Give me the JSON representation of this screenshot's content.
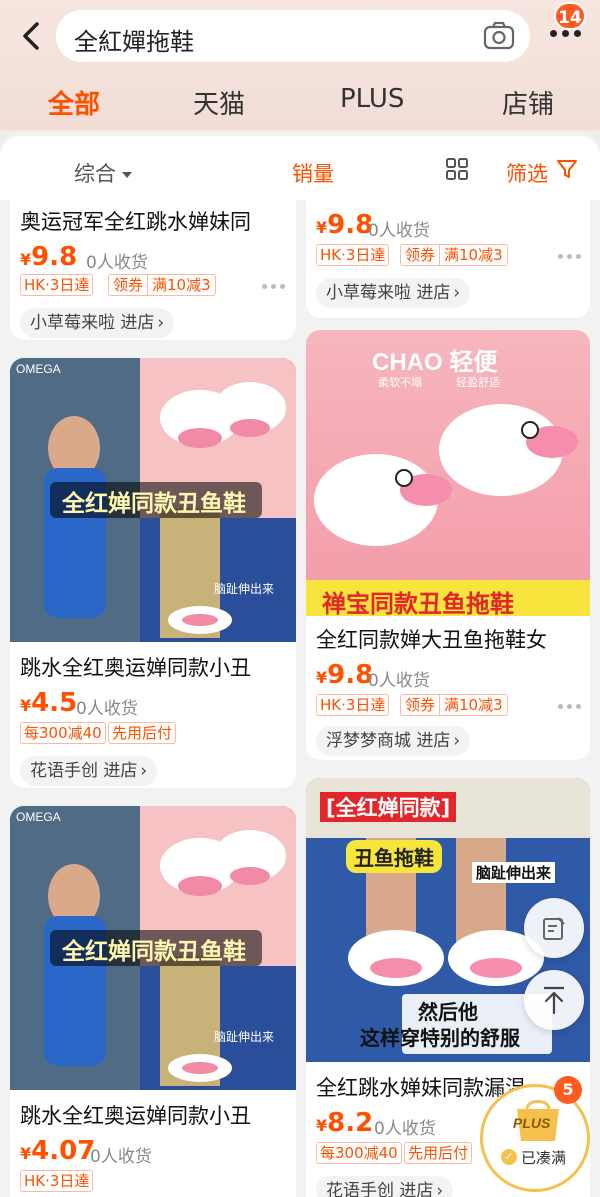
{
  "search": {
    "query": "全紅嬋拖鞋"
  },
  "header": {
    "notification_count": "14"
  },
  "tabs": [
    {
      "label": "全部"
    },
    {
      "label": "天猫"
    },
    {
      "label": "PLUS"
    },
    {
      "label": "店铺"
    }
  ],
  "filters": {
    "sort": "综合",
    "sales": "销量",
    "filter": "筛选"
  },
  "products": [
    {
      "title": "奥运冠军全红跳水婵妹同",
      "yen": "¥",
      "price": "9.8",
      "sold": "0人收货",
      "tags": [
        "HK·3日達"
      ],
      "coupon_tag": [
        "领券",
        "满10减3"
      ],
      "store": "小草莓来啦 进店"
    },
    {
      "title": "",
      "yen": "¥",
      "price": "9.8",
      "sold": "0人收货",
      "tags": [
        "HK·3日達"
      ],
      "coupon_tag": [
        "领券",
        "满10减3"
      ],
      "store": "小草莓来啦 进店"
    },
    {
      "title": "跳水全红奥运婵同款小丑",
      "yen": "¥",
      "price": "4.5",
      "sold": "0人收货",
      "tags": [
        "每300减40",
        "先用后付"
      ],
      "store": "花语手创 进店",
      "image_text": {
        "brand": "OMEGA",
        "overlay": "全红婵同款丑鱼鞋",
        "caption": "脑趾伸出来"
      }
    },
    {
      "title": "全红同款婵大丑鱼拖鞋女",
      "yen": "¥",
      "price": "9.8",
      "sold": "0人收货",
      "tags": [
        "HK·3日達"
      ],
      "coupon_tag": [
        "领券",
        "满10减3"
      ],
      "store": "浮梦梦商城 进店",
      "image_text": {
        "headline": "CHAO 轻便",
        "sub1": "柔软不塌",
        "sub2": "轻盈舒适",
        "banner": "禅宝同款丑鱼拖鞋"
      }
    },
    {
      "title": "跳水全红奥运婵同款小丑",
      "yen": "¥",
      "price": "4.07",
      "sold": "0人收货",
      "tags": [
        "HK·3日達"
      ],
      "store": "",
      "image_text": {
        "brand": "OMEGA",
        "overlay": "全红婵同款丑鱼鞋",
        "caption": "脑趾伸出来"
      }
    },
    {
      "title": "全红跳水婵妹同款漏温",
      "yen": "¥",
      "price": "8.2",
      "sold": "0人收货",
      "tags": [
        "每300减40",
        "先用后付"
      ],
      "store": "花语手创 进店",
      "image_text": {
        "top": "[全红婵同款]",
        "label": "丑鱼拖鞋",
        "caption": "脑趾伸出来",
        "bottom1": "然后他",
        "bottom2": "这样穿特别的舒服"
      }
    }
  ],
  "plus_cart": {
    "logo": "PLUS",
    "status": "已凑满",
    "count": "5"
  },
  "colors": {
    "accent": "#ff5000",
    "badge": "#ff5a1f",
    "plus_gold": "#f6c04d"
  },
  "icons": [
    "back-arrow-icon",
    "camera-icon",
    "more-dots-icon",
    "grid-view-icon",
    "filter-funnel-icon",
    "edit-note-icon",
    "back-to-top-icon",
    "cart-bag-icon"
  ]
}
